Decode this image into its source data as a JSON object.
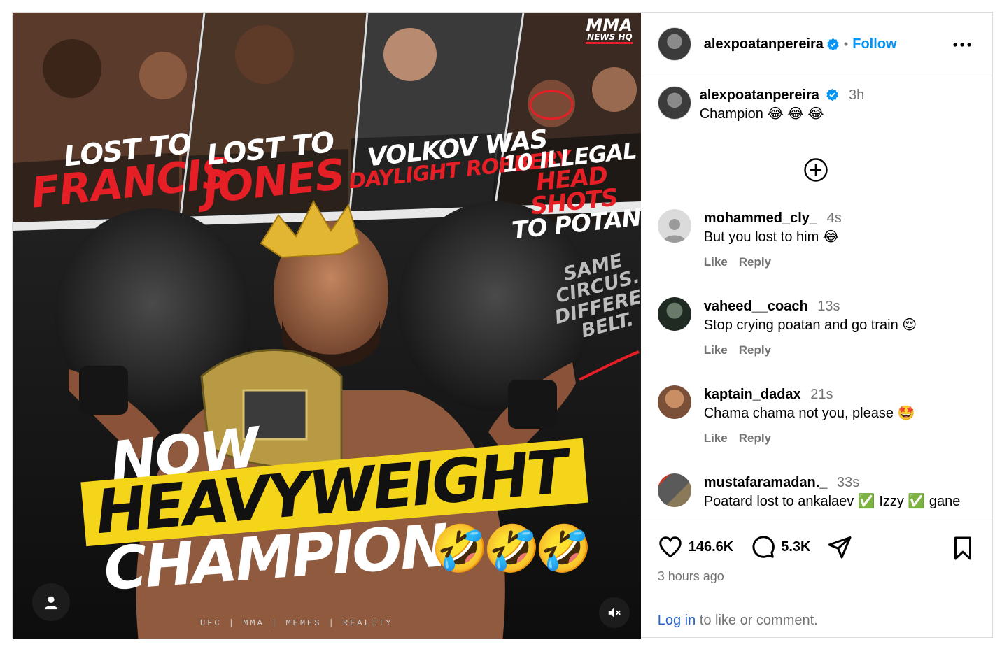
{
  "post": {
    "username": "alexpoatanpereira",
    "follow_label": "Follow",
    "more_label": "•••",
    "caption_username": "alexpoatanpereira",
    "caption_time": "3h",
    "caption_text": "Champion 😂 😂 😂"
  },
  "media": {
    "brand_top": "MMA",
    "brand_bottom": "NEWS HQ",
    "panels": [
      {
        "top": "LOST TO",
        "bottom": "FRANCIS"
      },
      {
        "top": "LOST TO",
        "bottom": "JONES"
      },
      {
        "top": "VOLKOV WAS",
        "bottom": "DAYLIGHT ROBBERY"
      },
      {
        "top": "10 ILLEGAL",
        "middle": "HEAD SHOTS",
        "bottom": "TO POTAN"
      }
    ],
    "side_note": "SAME CIRCUS. DIFFERENT BELT.",
    "headline_1": "NOW",
    "headline_2": "HEAVYWEIGHT",
    "headline_3": "CHAMPION",
    "headline_emoji": "🤣🤣🤣",
    "footer_tags": "UFC  |  MMA  |  MEMES  |  REALITY"
  },
  "comments": [
    {
      "username": "mohammed_cly_",
      "time": "4s",
      "text": "But you lost to him 😂",
      "like": "Like",
      "reply": "Reply",
      "avatar_color": "#dbdbdb"
    },
    {
      "username": "vaheed__coach",
      "time": "13s",
      "text": "Stop crying poatan and go train 😌",
      "like": "Like",
      "reply": "Reply",
      "avatar_color": "#2b3a2f"
    },
    {
      "username": "kaptain_dadax",
      "time": "21s",
      "text": "Chama chama not you, please 🤩",
      "like": "Like",
      "reply": "Reply",
      "avatar_color": "#a9714a"
    },
    {
      "username": "mustafaramadan._",
      "time": "33s",
      "text": "Poatard lost to ankalaev ✅ Izzy ✅ gane",
      "like": "Like",
      "reply": "Reply",
      "avatar_color": "#6b5a4a"
    }
  ],
  "actions": {
    "likes": "146.6K",
    "comments": "5.3K",
    "time_ago": "3 hours ago",
    "login_link": "Log in",
    "login_rest": " to like or comment."
  },
  "colors": {
    "accent": "#0095f6",
    "muted": "#737373",
    "brand_red": "#e61e25",
    "banner_yellow": "#f4d51a"
  }
}
